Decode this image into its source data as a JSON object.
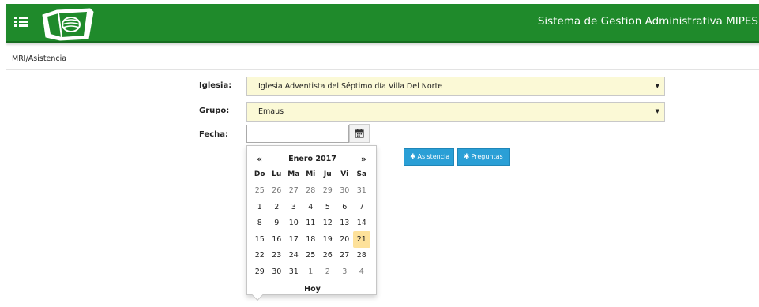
{
  "header": {
    "title": "Sistema de Gestion Administrativa MIPES",
    "menu_icon": "hamburger-icon",
    "logo_icon": "bible-logo-icon",
    "bg_color": "#1f8a2b"
  },
  "breadcrumb": "MRI/Asistencia",
  "form": {
    "iglesia": {
      "label": "Iglesia:",
      "value": "Iglesia Adventista del Séptimo día Villa Del Norte"
    },
    "grupo": {
      "label": "Grupo:",
      "value": "Emaus"
    },
    "fecha": {
      "label": "Fecha:",
      "value": ""
    }
  },
  "buttons": {
    "asistencia": "Asistencia",
    "preguntas": "Preguntas",
    "color": "#2a9fd6"
  },
  "datepicker": {
    "prev": "«",
    "next": "»",
    "month": "Enero 2017",
    "today_label": "Hoy",
    "weekdays": [
      "Do",
      "Lu",
      "Ma",
      "Mi",
      "Ju",
      "Vi",
      "Sa"
    ],
    "weeks": [
      [
        {
          "d": "25",
          "other": true
        },
        {
          "d": "26",
          "other": true
        },
        {
          "d": "27",
          "other": true
        },
        {
          "d": "28",
          "other": true
        },
        {
          "d": "29",
          "other": true
        },
        {
          "d": "30",
          "other": true
        },
        {
          "d": "31",
          "other": true
        }
      ],
      [
        {
          "d": "1"
        },
        {
          "d": "2"
        },
        {
          "d": "3"
        },
        {
          "d": "4"
        },
        {
          "d": "5"
        },
        {
          "d": "6"
        },
        {
          "d": "7"
        }
      ],
      [
        {
          "d": "8"
        },
        {
          "d": "9"
        },
        {
          "d": "10"
        },
        {
          "d": "11"
        },
        {
          "d": "12"
        },
        {
          "d": "13"
        },
        {
          "d": "14"
        }
      ],
      [
        {
          "d": "15"
        },
        {
          "d": "16"
        },
        {
          "d": "17"
        },
        {
          "d": "18"
        },
        {
          "d": "19"
        },
        {
          "d": "20"
        },
        {
          "d": "21",
          "today": true
        }
      ],
      [
        {
          "d": "22"
        },
        {
          "d": "23"
        },
        {
          "d": "24"
        },
        {
          "d": "25"
        },
        {
          "d": "26"
        },
        {
          "d": "27"
        },
        {
          "d": "28"
        }
      ],
      [
        {
          "d": "29"
        },
        {
          "d": "30"
        },
        {
          "d": "31"
        },
        {
          "d": "1",
          "other": true
        },
        {
          "d": "2",
          "other": true
        },
        {
          "d": "3",
          "other": true
        },
        {
          "d": "4",
          "other": true
        }
      ]
    ],
    "today_highlight": "#fde19a"
  }
}
